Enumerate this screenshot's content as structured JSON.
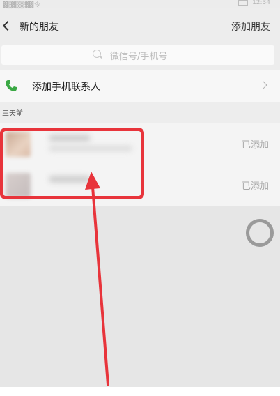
{
  "status_bar": {
    "left_indicators": "▓▒▓▒▒ ▓▓ 令",
    "right_time": "12:34"
  },
  "nav": {
    "back_icon": "chevron-left-icon",
    "title": "新的朋友",
    "action_label": "添加朋友"
  },
  "search": {
    "icon": "search-icon",
    "placeholder": "微信号/手机号"
  },
  "contacts_entry": {
    "icon": "phone-icon",
    "label": "添加手机联系人"
  },
  "section": {
    "header": "三天前"
  },
  "friends": [
    {
      "status": "已添加"
    },
    {
      "status": "已添加"
    }
  ],
  "colors": {
    "highlight": "#e8343b",
    "phone_icon": "#3aa844"
  }
}
